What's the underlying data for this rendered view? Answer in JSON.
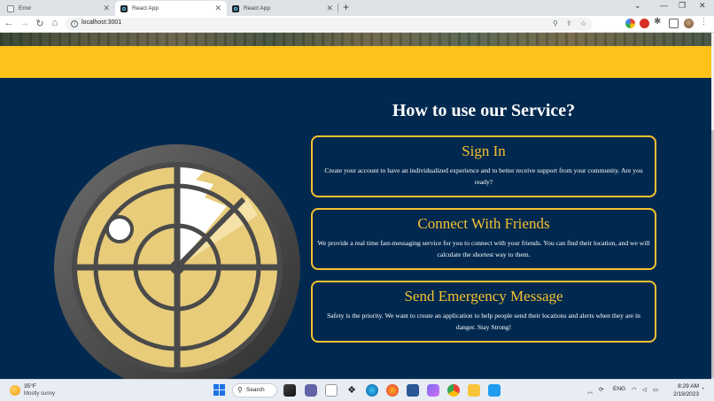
{
  "browser": {
    "tabs": [
      {
        "title": "Error",
        "icon": "warning-favicon-icon",
        "active": false
      },
      {
        "title": "React App",
        "icon": "react-favicon-icon",
        "active": true
      },
      {
        "title": "React App",
        "icon": "react-favicon-icon",
        "active": false
      }
    ],
    "url": "localhost:3001"
  },
  "page": {
    "colors": {
      "navy": "#01294f",
      "gold": "#fdc31a",
      "card_border": "#f6c22e"
    },
    "illustration": "radar-icon",
    "section_title": "How to use our Service?",
    "cards": [
      {
        "title": "Sign In",
        "text": "Create your account to have an individualized experience and to better receive support from your community. Are you ready?"
      },
      {
        "title": "Connect With Friends",
        "text": "We provide a real time fast-messaging service for you to connect with your friends. You can find their location, and we will calculate the shortest way to them."
      },
      {
        "title": "Send Emergency Message",
        "text": "Safety is the priority. We want to create an application to help people send their locations and alerts when they are in danger. Stay Strong!"
      }
    ]
  },
  "taskbar": {
    "weather": {
      "temp": "35°F",
      "desc": "Mostly sunny"
    },
    "search_label": "Search",
    "language": "ENG",
    "time": "8:29 AM",
    "date": "2/19/2023"
  }
}
